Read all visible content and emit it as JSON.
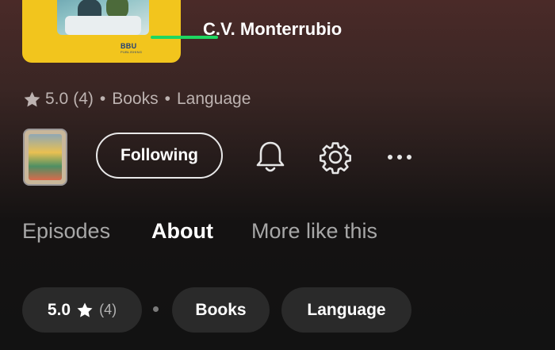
{
  "podcast": {
    "author": "C.V. Monterrubio",
    "cover_logo": "BBU",
    "cover_logo_sub": "PUBLISHING"
  },
  "meta": {
    "rating": "5.0",
    "rating_count": "(4)",
    "separator": "•",
    "category": "Books",
    "subcategory": "Language"
  },
  "actions": {
    "follow_label": "Following",
    "icons": [
      "bell-icon",
      "gear-icon",
      "more-icon"
    ]
  },
  "tabs": [
    {
      "label": "Episodes",
      "active": false
    },
    {
      "label": "About",
      "active": true
    },
    {
      "label": "More like this",
      "active": false
    }
  ],
  "chips": {
    "rating": "5.0",
    "rating_count": "(4)",
    "category": "Books",
    "subcategory": "Language"
  },
  "colors": {
    "accent": "#1ed760",
    "cover_bg": "#f2c51d",
    "chip_bg": "#2a2a2a"
  }
}
